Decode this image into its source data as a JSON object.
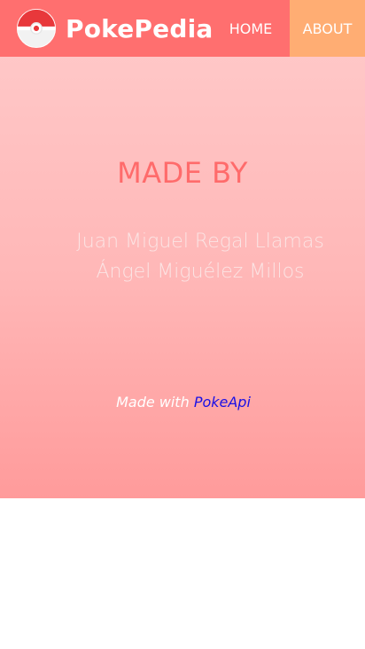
{
  "navbar": {
    "brand": "PokePedia",
    "links": [
      {
        "label": "HOME"
      },
      {
        "label": "ABOUT"
      }
    ],
    "logo_icon": "pokeball-icon"
  },
  "about": {
    "heading": "MADE BY",
    "authors": [
      "Juan Miguel Regal Llamas",
      "Ángel Miguélez Millos"
    ],
    "credit_prefix": "Made with",
    "credit_link": "PokeApi"
  },
  "colors": {
    "navbar": "#ff6f6f",
    "active_tab": "#ffad73",
    "heading": "#ff6b6b",
    "link": "#1a10e6"
  }
}
